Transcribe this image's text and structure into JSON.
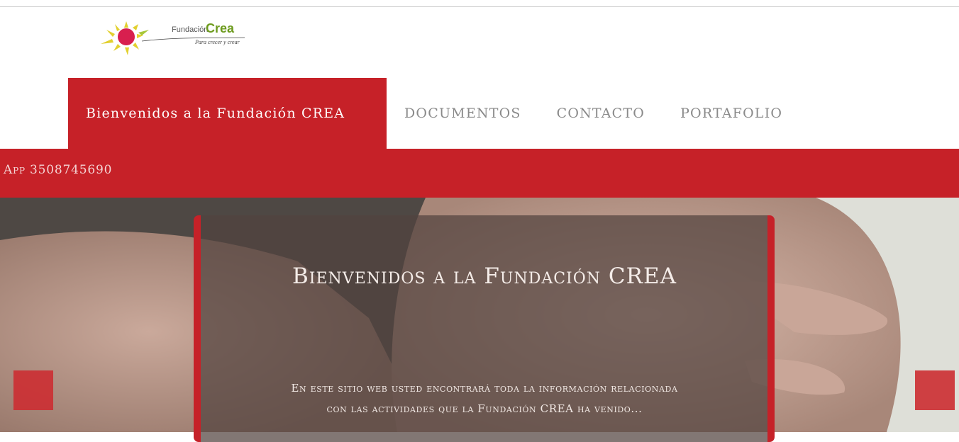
{
  "logo": {
    "word_1": "Fundación",
    "word_2": "Crea",
    "tagline": "Para crecer y crear"
  },
  "nav": {
    "items": [
      {
        "label": "Bienvenidos a la Fundación CREA",
        "active": true
      },
      {
        "label": "DOCUMENTOS"
      },
      {
        "label": "CONTACTO"
      },
      {
        "label": "PORTAFOLIO"
      }
    ]
  },
  "infobar": {
    "text": "App 3508745690"
  },
  "hero": {
    "title": "Bienvenidos a la Fundación CREA",
    "text": "En este sitio web usted encontrará toda la información relacionada con las actividades que la Fundación CREA ha venido..."
  },
  "colors": {
    "brand_red": "#c62128",
    "nav_text": "#8a8a8a",
    "logo_green": "#6d9b1e",
    "sun_pink": "#d81f4f"
  },
  "icons": {
    "prev": "arrow-left-icon",
    "next": "arrow-right-icon"
  }
}
